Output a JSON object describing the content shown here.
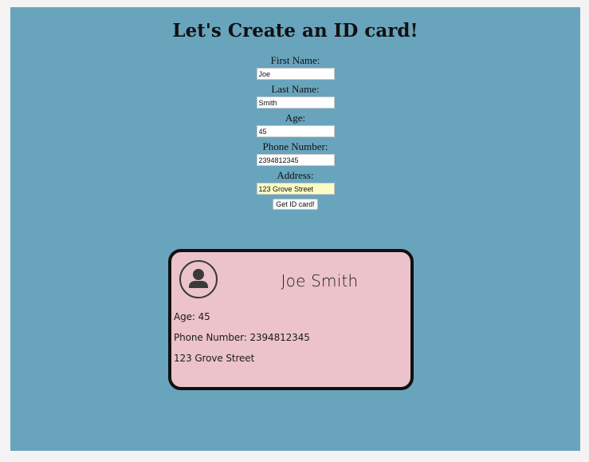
{
  "header": {
    "title": "Let's Create an ID card!"
  },
  "form": {
    "first_name": {
      "label": "First Name:",
      "value": "Joe"
    },
    "last_name": {
      "label": "Last Name:",
      "value": "Smith"
    },
    "age": {
      "label": "Age:",
      "value": "45"
    },
    "phone": {
      "label": "Phone Number:",
      "value": "2394812345"
    },
    "address": {
      "label": "Address:",
      "value": "123 Grove Street"
    },
    "submit_label": "Get ID card!"
  },
  "card": {
    "avatar_icon": "person-avatar-icon",
    "name": "Joe Smith",
    "age_line": "Age: 45",
    "phone_line": "Phone Number: 2394812345",
    "address_line": "123 Grove Street"
  },
  "colors": {
    "page_background": "#69a4bd",
    "card_background": "#ecc3ca",
    "card_border": "#111111",
    "autofill_highlight": "#fbfbc4"
  }
}
